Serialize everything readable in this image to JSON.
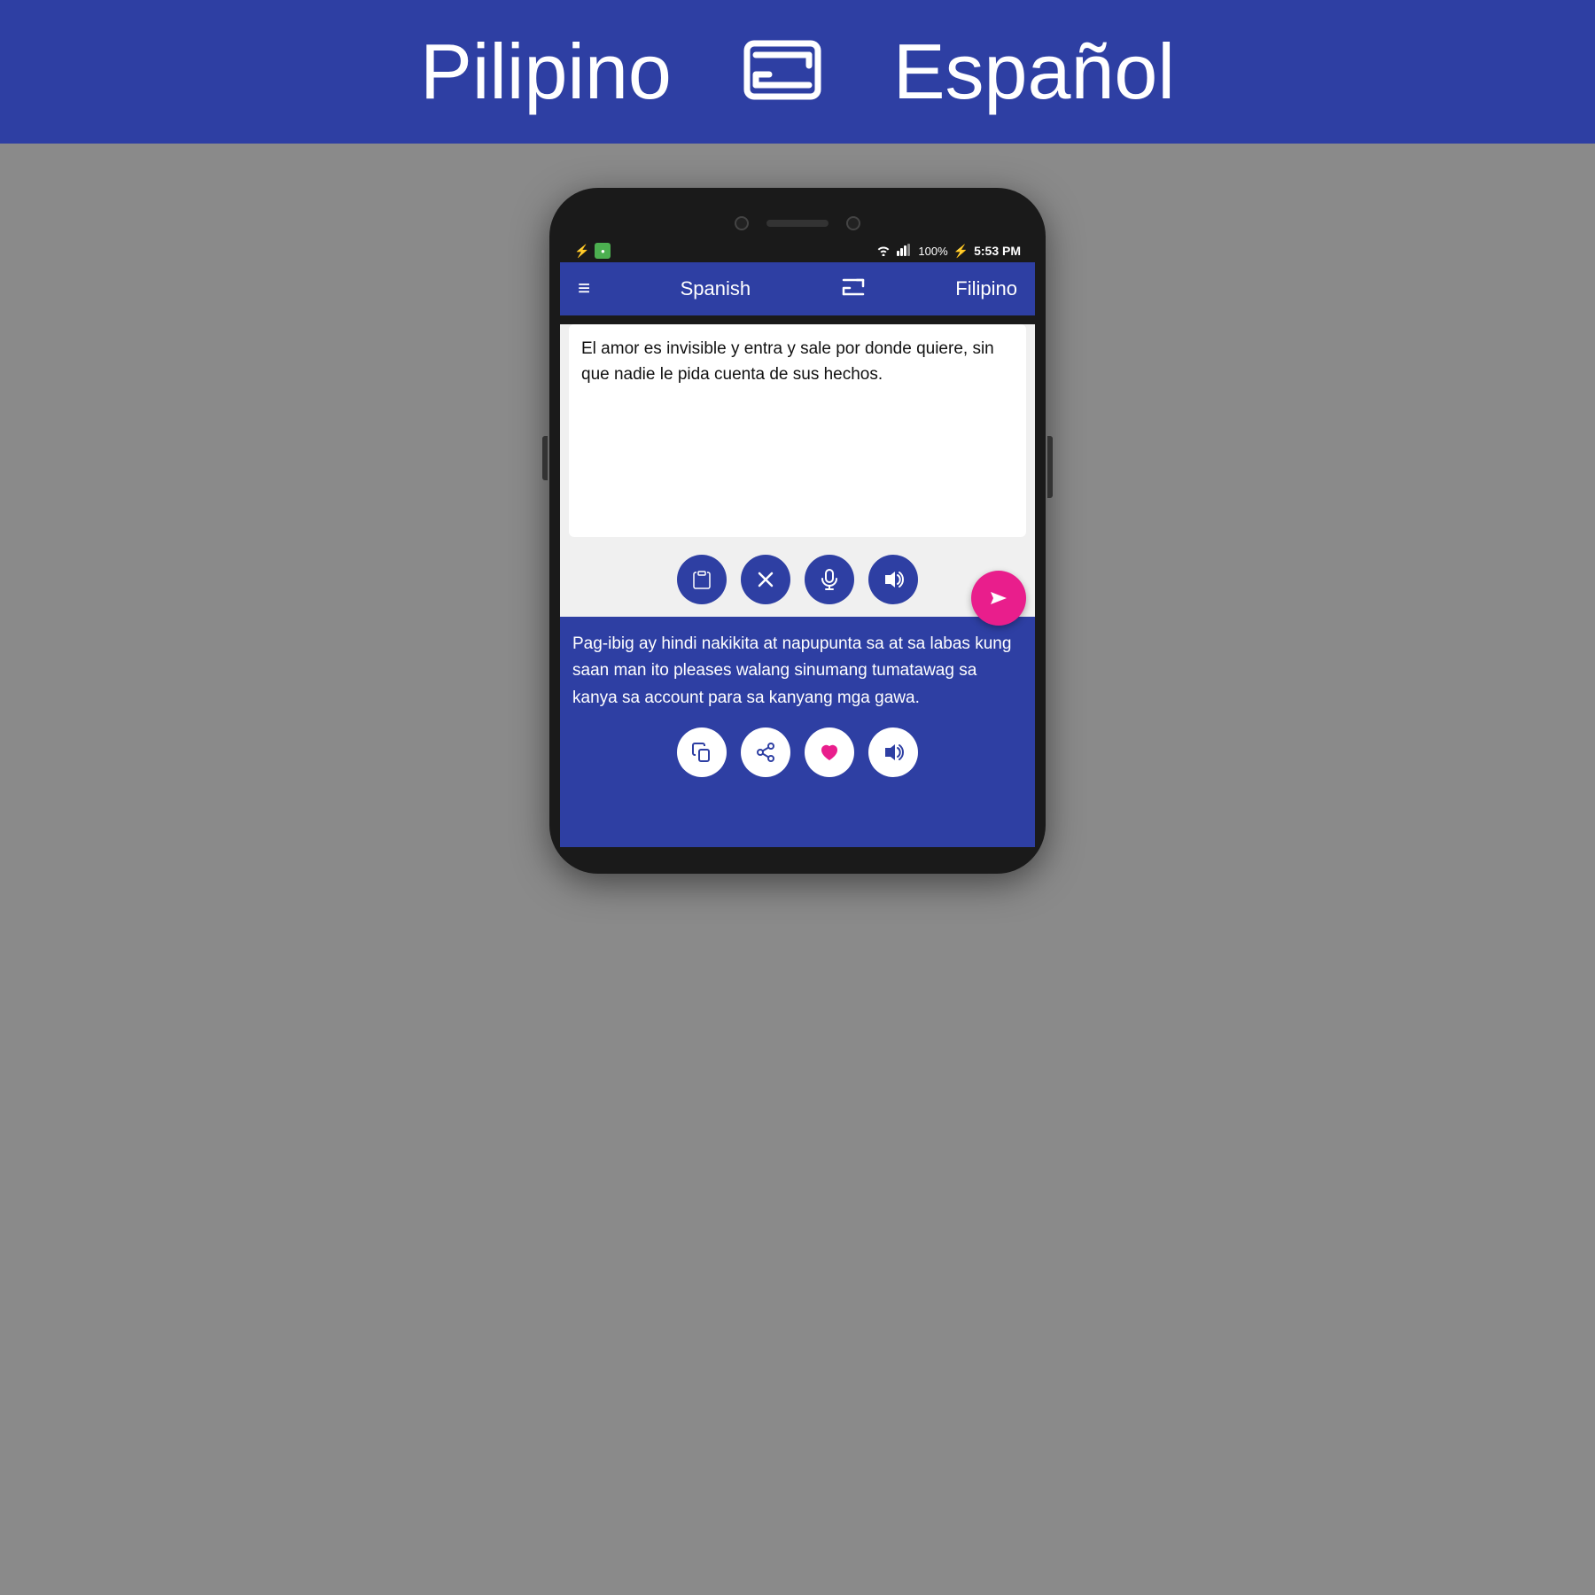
{
  "banner": {
    "lang_left": "Pilipino",
    "lang_right": "Español",
    "swap_icon": "⇄"
  },
  "status_bar": {
    "time": "5:53 PM",
    "battery": "100%"
  },
  "app_bar": {
    "lang_left": "Spanish",
    "lang_right": "Filipino"
  },
  "input": {
    "text": "El amor es invisible y entra y sale por donde quiere, sin que nadie le pida cuenta de sus hechos."
  },
  "output": {
    "text": "Pag-ibig ay hindi nakikita at napupunta sa at sa labas kung saan man ito pleases walang sinumang tumatawag sa kanya sa account para sa kanyang mga gawa."
  },
  "buttons": {
    "clipboard": "📋",
    "close": "✕",
    "mic": "🎤",
    "sound": "🔊",
    "send": "▶",
    "copy": "⧉",
    "share": "⬆",
    "favorite": "♥",
    "volume": "🔊"
  }
}
